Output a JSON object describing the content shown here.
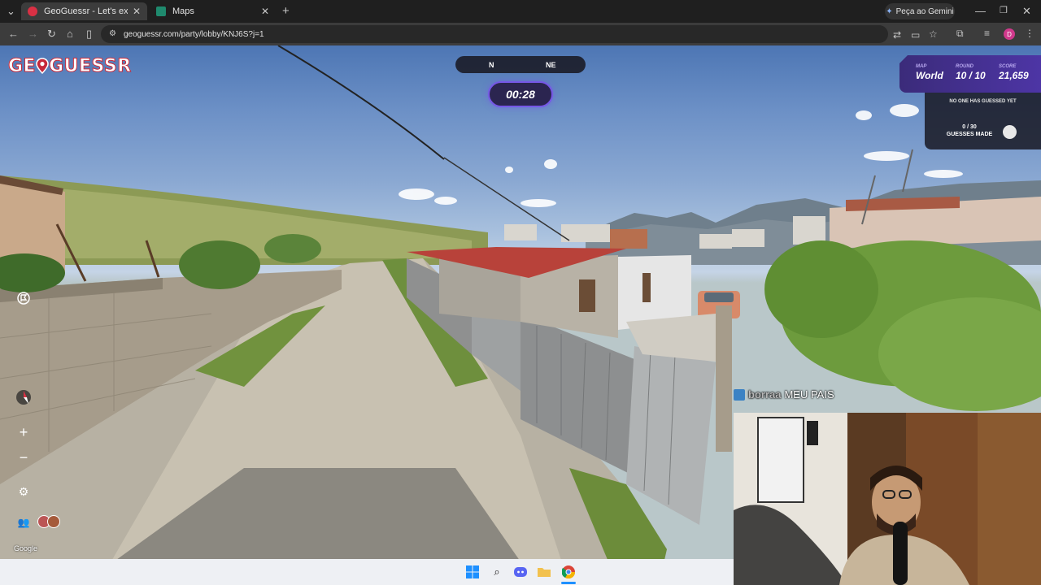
{
  "browser": {
    "tabs": [
      {
        "title": "GeoGuessr - Let's explore the w",
        "active": true
      },
      {
        "title": "Maps",
        "active": false
      }
    ],
    "new_tab": "+",
    "gemini_label": "Peça ao Gemini",
    "url": "geoguessr.com/party/lobby/KNJ6S?j=1",
    "profile_initial": "D"
  },
  "game": {
    "logo": "GE",
    "logo_tail": "GUESSR",
    "compass": {
      "left": "N",
      "right": "NE"
    },
    "timer": "00:28",
    "status": {
      "map_label": "MAP",
      "map_value": "World",
      "round_label": "ROUND",
      "round_value": "10 / 10",
      "score_label": "SCORE",
      "score_value": "21,659"
    },
    "guess_status": "NO ONE HAS GUESSED YET",
    "guesses_count": "0 / 30",
    "guesses_label": "GUESSES MADE",
    "zoom_in": "+",
    "zoom_out": "−",
    "attribution": "Google"
  },
  "chat": {
    "user": "borraa",
    "message": "MEU PAIS"
  },
  "colors": {
    "brand": "#c6283a",
    "accent": "#7657e6",
    "panel": "#3b2b7a"
  },
  "taskbar": {
    "icons": [
      "windows-icon",
      "search-icon",
      "discord-icon",
      "folder-icon",
      "chrome-icon"
    ]
  }
}
